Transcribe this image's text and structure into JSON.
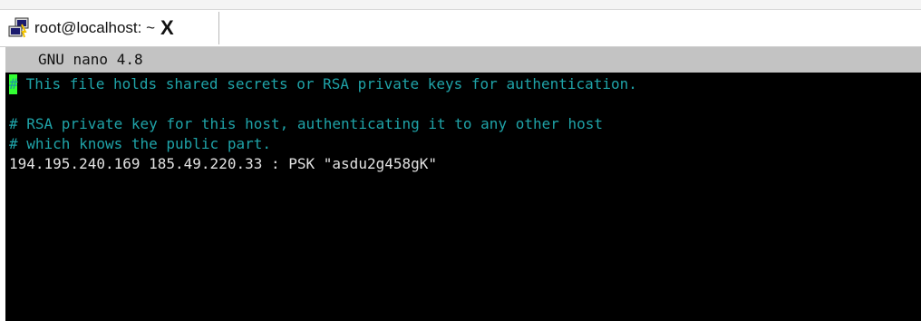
{
  "tab": {
    "title": "root@localhost: ~",
    "close": "X",
    "icon": "putty-icon"
  },
  "editor": {
    "titlebar": "GNU nano 4.8",
    "cursor_char": "#",
    "lines": [
      " This file holds shared secrets or RSA private keys for authentication.",
      "",
      "# RSA private key for this host, authenticating it to any other host",
      "# which knows the public part.",
      "194.195.240.169 185.49.220.33 : PSK \"asdu2g458gK\""
    ]
  },
  "colors": {
    "terminal_bg": "#000000",
    "titlebar_bg": "#c3c3c3",
    "comment": "#1fa3a8",
    "cursor": "#33ff33",
    "plain_text": "#e2e2e2"
  }
}
